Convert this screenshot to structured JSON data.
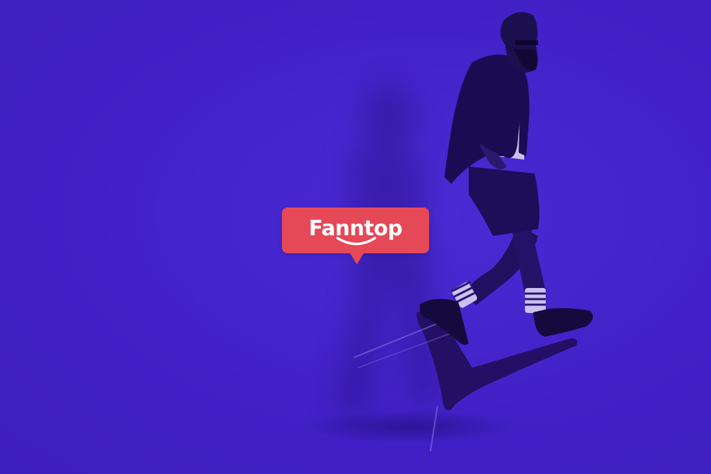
{
  "brand": {
    "name": "Fanntop",
    "badge_color": "#e54857",
    "text_color": "#ffffff"
  },
  "scene": {
    "background_color": "#4121c7",
    "subject": "bearded-man-riding-chair-icon"
  }
}
